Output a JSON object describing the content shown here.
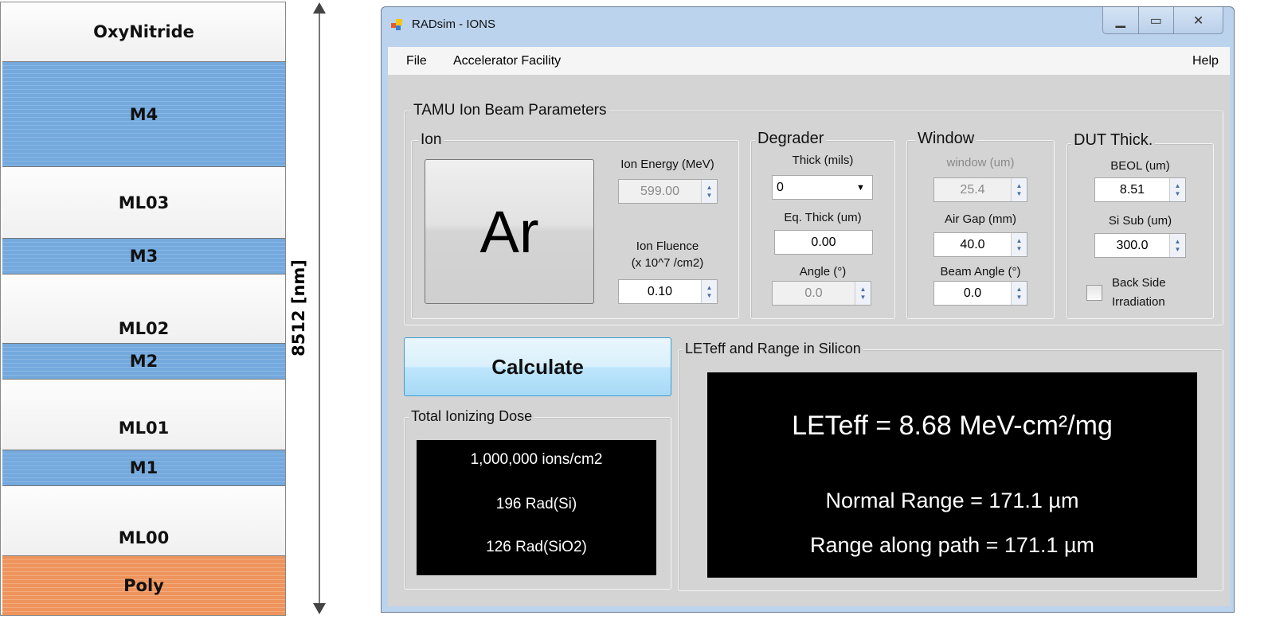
{
  "diagram": {
    "layers": [
      {
        "label": "OxyNitride",
        "type": "oxide"
      },
      {
        "label": "M4",
        "type": "metal"
      },
      {
        "label": "ML03",
        "type": "oxide"
      },
      {
        "label": "M3",
        "type": "metal"
      },
      {
        "label": "ML02",
        "type": "oxide"
      },
      {
        "label": "M2",
        "type": "metal"
      },
      {
        "label": "ML01",
        "type": "oxide"
      },
      {
        "label": "M1",
        "type": "metal"
      },
      {
        "label": "ML00",
        "type": "oxide"
      },
      {
        "label": "Poly",
        "type": "poly"
      }
    ],
    "dimension_label": "8512 [nm]",
    "colors": {
      "metal": "#74a9dd",
      "poly": "#ee945c",
      "oxide": "#f5f5f5"
    }
  },
  "window": {
    "title": "RADsim - IONS",
    "menu": {
      "file": "File",
      "accelerator": "Accelerator Facility",
      "help": "Help"
    },
    "beam_group": "TAMU Ion Beam Parameters",
    "ion": {
      "group": "Ion",
      "ion_button": "Ar",
      "energy_label": "Ion Energy (MeV)",
      "energy_value": "599.00",
      "fluence_label1": "Ion Fluence",
      "fluence_label2": "(x 10^7 /cm2)",
      "fluence_value": "0.10"
    },
    "degrader": {
      "group": "Degrader",
      "thick_label": "Thick (mils)",
      "thick_value": "0",
      "eq_label": "Eq. Thick (um)",
      "eq_value": "0.00",
      "angle_label": "Angle (°)",
      "angle_value": "0.0"
    },
    "windowgrp": {
      "group": "Window",
      "window_label": "window (um)",
      "window_value": "25.4",
      "airgap_label": "Air Gap (mm)",
      "airgap_value": "40.0",
      "beam_angle_label": "Beam Angle (°)",
      "beam_angle_value": "0.0"
    },
    "dut": {
      "group": "DUT Thick.",
      "beol_label": "BEOL (um)",
      "beol_value": "8.51",
      "sisub_label": "Si Sub (um)",
      "sisub_value": "300.0",
      "backside_label1": "Back Side",
      "backside_label2": "Irradiation",
      "backside_checked": false
    },
    "calculate": "Calculate",
    "tid": {
      "group": "Total Ionizing Dose",
      "line1": "1,000,000  ions/cm2",
      "line2": "196  Rad(Si)",
      "line3": "126  Rad(SiO2)"
    },
    "let": {
      "group": "LETeff and Range in Silicon",
      "leteff": "LETeff  =  8.68 MeV-cm²/mg",
      "normal_range": "Normal Range = 171.1 µm",
      "path_range": "Range along path = 171.1 µm"
    }
  }
}
